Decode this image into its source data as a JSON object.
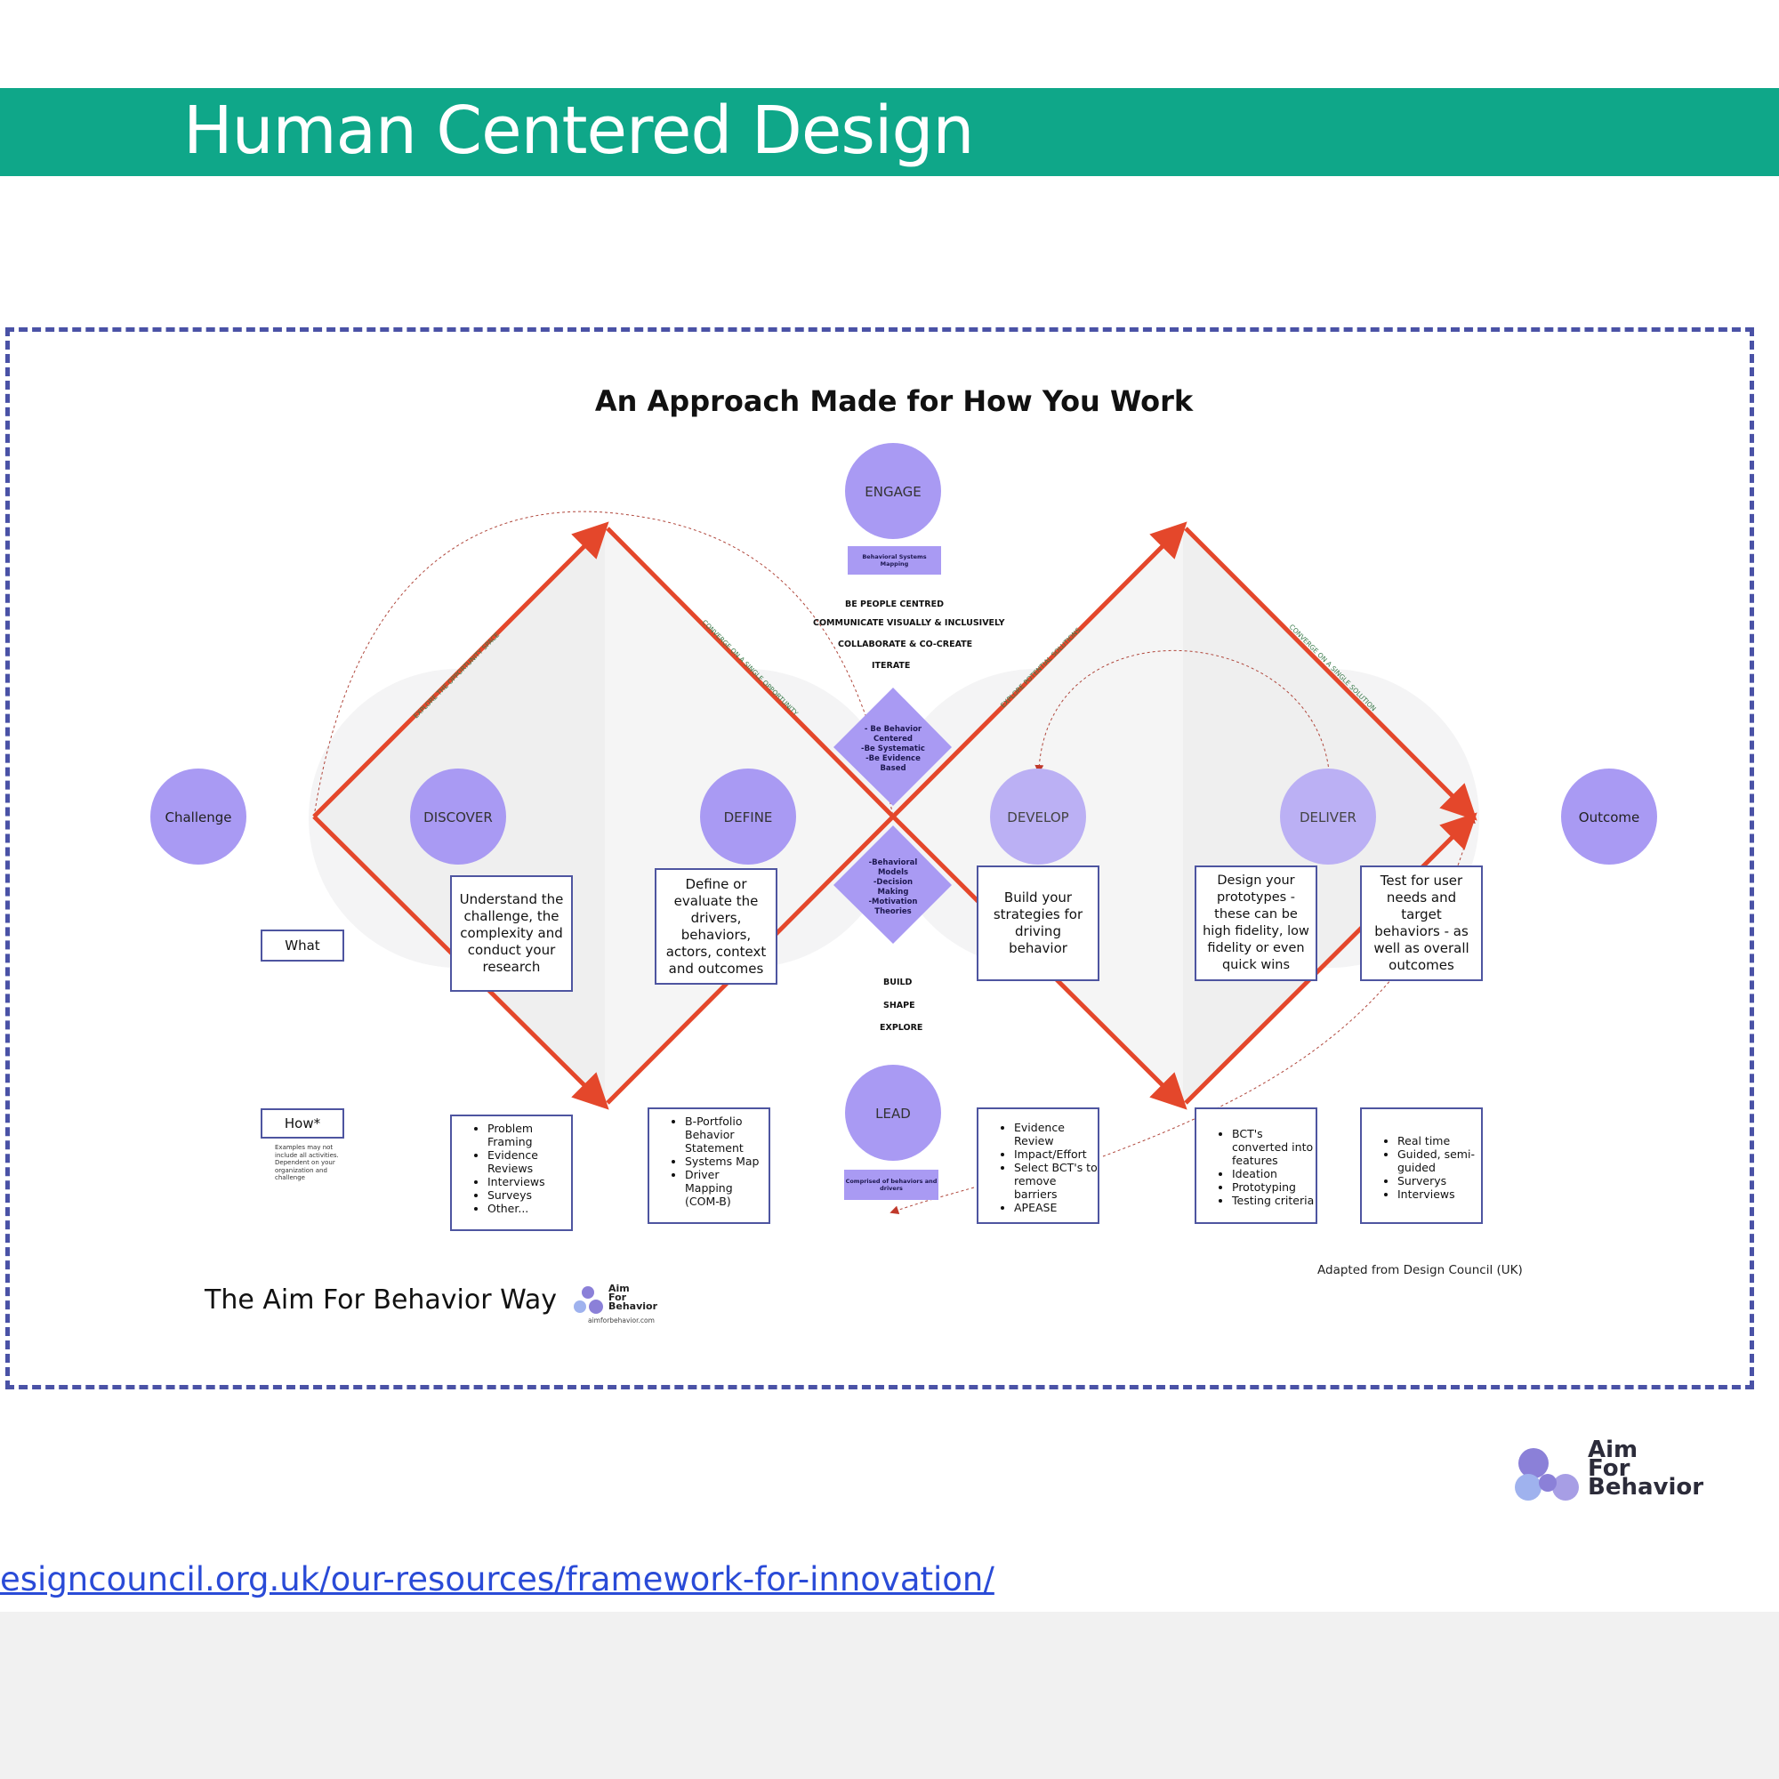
{
  "header": {
    "title": "Human Centered Design"
  },
  "diagram": {
    "title": "An Approach Made for How You Work",
    "nodes": {
      "challenge": "Challenge",
      "discover": "DISCOVER",
      "define": "DEFINE",
      "develop": "DEVELOP",
      "deliver": "DELIVER",
      "outcome": "Outcome",
      "engage": "ENGAGE",
      "lead": "LEAD"
    },
    "engage_box": "Behavioral Systems Mapping",
    "lead_box": "Comprised of behaviors and drivers",
    "principles": [
      "BE PEOPLE CENTRED",
      "COMMUNICATE VISUALLY & INCLUSIVELY",
      "COLLABORATE & CO-CREATE",
      "ITERATE"
    ],
    "lead_actions": [
      "BUILD",
      "SHAPE",
      "EXPLORE"
    ],
    "diamond_top": [
      "- Be Behavior",
      "Centered",
      "-Be Systematic",
      "-Be Evidence",
      "Based"
    ],
    "diamond_bottom": [
      "-Behavioral",
      "Models",
      "-Decision",
      "Making",
      "-Motivation",
      "Theories"
    ],
    "edge_labels": {
      "explore_opportunity": "EXPLORE THE OPPORTUNITY SPACE",
      "converge_opportunity": "CONVERGE ON A SINGLE OPPORTUNITY",
      "explore_solutions": "EXPLORE POTENTIAL SOLUTIONS",
      "converge_solution": "CONVERGE ON A SINGLE SOLUTION"
    },
    "what_label": "What",
    "how_label": "How*",
    "how_note": [
      "Examples may not",
      "include all activities.",
      "Dependent on your",
      "organization and",
      "challenge"
    ],
    "what_boxes": {
      "discover": "Understand the challenge, the complexity and conduct your research",
      "define": "Define or evaluate the drivers, behaviors, actors, context and outcomes",
      "develop": "Build your strategies for driving behavior",
      "deliver": "Design your prototypes - these can be high fidelity, low fidelity or even quick wins",
      "outcome": "Test for user needs and target behaviors - as well as overall outcomes"
    },
    "how_boxes": {
      "discover": [
        "Problem Framing",
        "Evidence Reviews",
        "Interviews",
        "Surveys",
        "Other..."
      ],
      "define": [
        "B-Portfolio Behavior Statement",
        "Systems Map",
        "Driver Mapping (COM-B)"
      ],
      "develop": [
        "Evidence Review",
        "Impact/Effort",
        "Select BCT's to remove barriers",
        "APEASE"
      ],
      "deliver": [
        "BCT's converted into features",
        "Ideation",
        "Prototyping",
        "Testing criteria"
      ],
      "outcome": [
        "Real time",
        "Guided, semi-guided",
        "Surverys",
        "Interviews"
      ]
    },
    "credit": "Adapted from Design Council (UK)",
    "brand_line": "The Aim For Behavior Way",
    "brand_small": {
      "line1": "Aim",
      "line2": "For",
      "line3": "Behavior",
      "url": "aimforbehavior.com"
    }
  },
  "logo": {
    "line1": "Aim",
    "line2": "For",
    "line3": "Behavior"
  },
  "footer": {
    "link": "esigncouncil.org.uk/our-resources/framework-for-innovation/"
  },
  "colors": {
    "banner": "#0fa789",
    "node": "#a99af3",
    "arrow": "#e4472b",
    "frame": "#4a52a6"
  }
}
